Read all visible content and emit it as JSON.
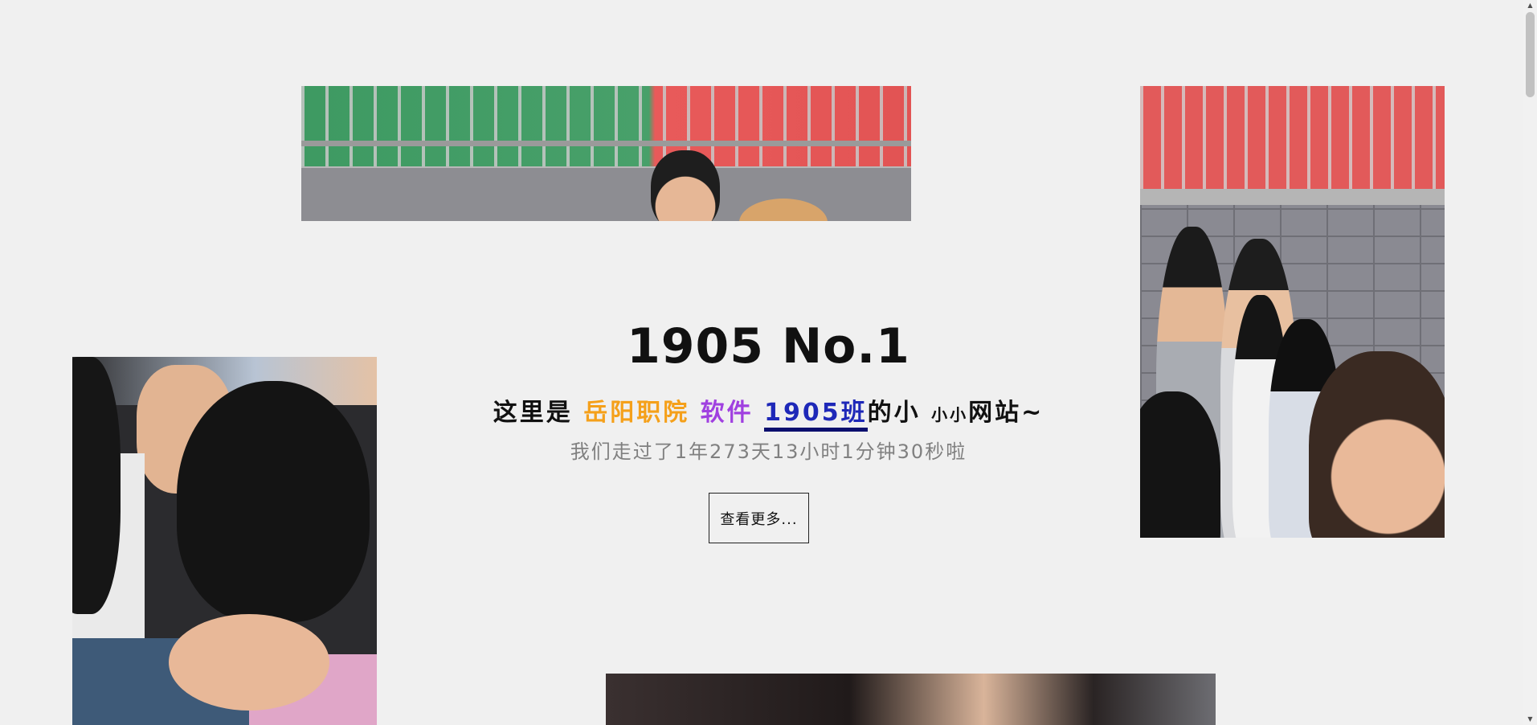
{
  "hero": {
    "title": "1905 No.1",
    "subtitle": {
      "prefix": "这里是 ",
      "school": "岳阳职院",
      "major": " 软件 ",
      "class": "1905班",
      "mid": "的小 ",
      "tiny": "小小",
      "suffix": "网站~"
    },
    "timer": "我们走过了1年273天13小时1分钟30秒啦",
    "more_button": "查看更多..."
  },
  "colors": {
    "school": "#f5a01a",
    "major": "#a040e0",
    "class": "#1e28b8",
    "background": "#f0f0f0"
  },
  "photos": [
    {
      "name": "group-photo-top",
      "alt": "class photo"
    },
    {
      "name": "group-photo-right",
      "alt": "class photo"
    },
    {
      "name": "group-photo-left",
      "alt": "class photo"
    },
    {
      "name": "group-photo-bottom",
      "alt": "class photo"
    }
  ],
  "scrollbar": {
    "up_icon": "▲",
    "down_icon": "▼"
  }
}
